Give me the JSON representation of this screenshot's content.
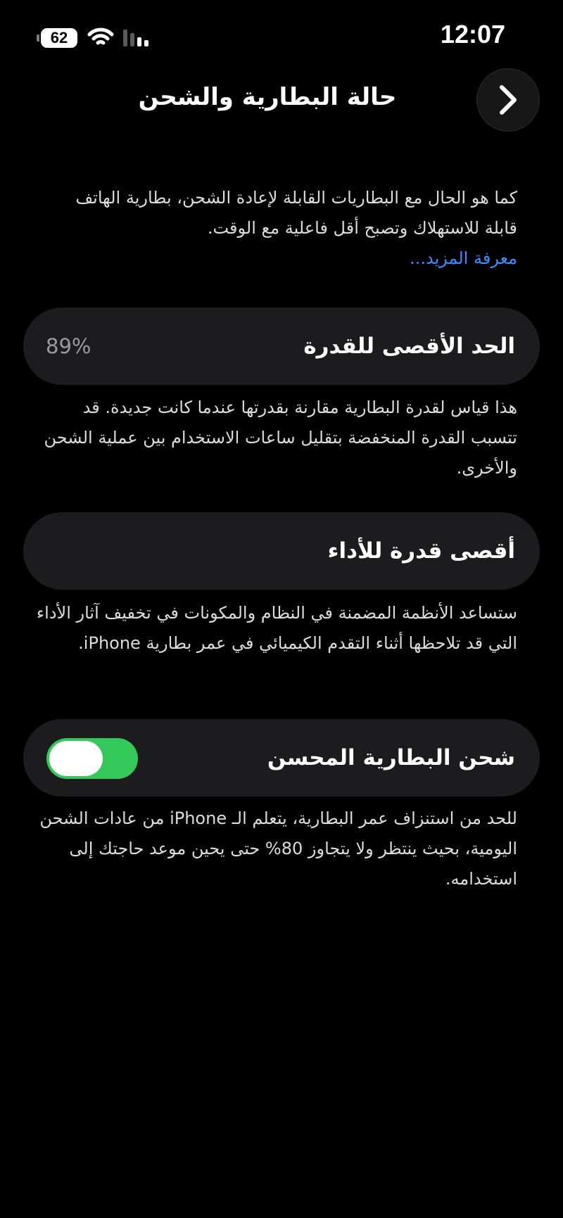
{
  "status_bar": {
    "time": "12:07",
    "battery_level": "62",
    "icons": [
      "battery-icon",
      "wifi-icon",
      "cellular-signal-icon"
    ]
  },
  "nav": {
    "title": "حالة البطارية والشحن",
    "back_icon": "chevron-right-icon"
  },
  "intro": {
    "text": "كما هو الحال مع البطاريات القابلة لإعادة الشحن، بطارية الهاتف قابلة للاستهلاك وتصبح أقل فاعلية مع الوقت.",
    "learn_more": "معرفة المزيد..."
  },
  "maximum_capacity": {
    "label": "الحد الأقصى للقدرة",
    "value": "89%",
    "description": "هذا قياس لقدرة البطارية مقارنة بقدرتها عندما كانت جديدة. قد تتسبب القدرة المنخفضة بتقليل ساعات الاستخدام بين عملية الشحن والأخرى."
  },
  "peak_performance": {
    "label": "أقصى قدرة للأداء",
    "description": "ستساعد الأنظمة المضمنة في النظام والمكونات في تخفيف آثار الأداء التي قد تلاحظها أثناء التقدم الكيميائي في عمر بطارية iPhone."
  },
  "optimized_charging": {
    "label": "شحن البطارية المحسن",
    "enabled": true,
    "description": "للحد من استنزاف عمر البطارية، يتعلم الـ iPhone من عادات الشحن اليومية، بحيث ينتظر ولا يتجاوز 80% حتى يحين موعد حاجتك إلى استخدامه."
  },
  "colors": {
    "background": "#000000",
    "card": "#1c1c1e",
    "accent_link": "#3c8dff",
    "toggle_on": "#34c759"
  }
}
